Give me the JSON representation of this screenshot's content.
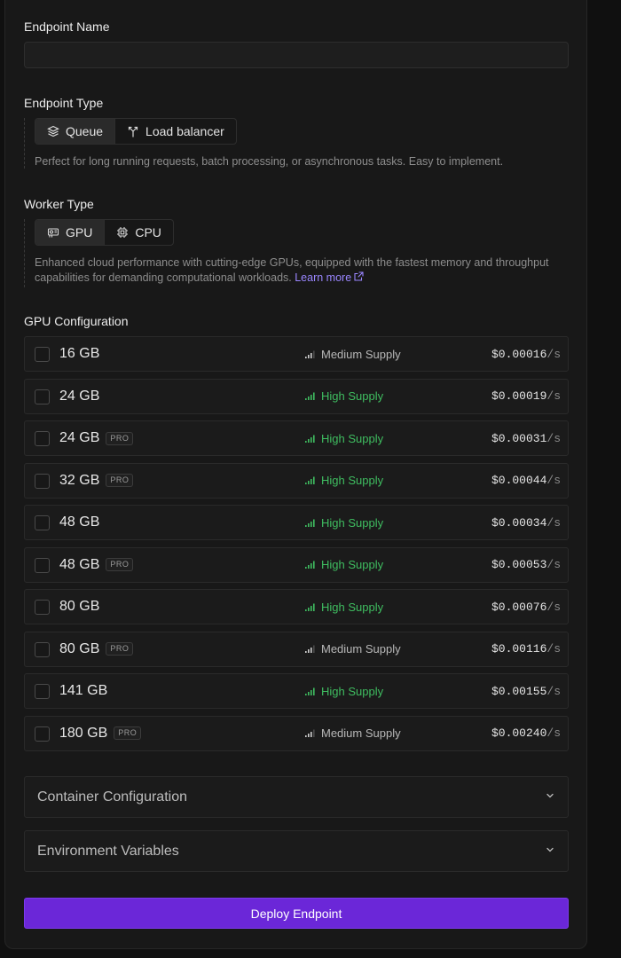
{
  "endpoint_name": {
    "label": "Endpoint Name",
    "value": "",
    "placeholder": ""
  },
  "endpoint_type": {
    "label": "Endpoint Type",
    "options": [
      {
        "label": "Queue",
        "icon": "layers-icon",
        "selected": true
      },
      {
        "label": "Load balancer",
        "icon": "split-arrow-icon",
        "selected": false
      }
    ],
    "description": "Perfect for long running requests, batch processing, or asynchronous tasks. Easy to implement."
  },
  "worker_type": {
    "label": "Worker Type",
    "options": [
      {
        "label": "GPU",
        "icon": "gpu-icon",
        "selected": true
      },
      {
        "label": "CPU",
        "icon": "cpu-icon",
        "selected": false
      }
    ],
    "description": "Enhanced cloud performance with cutting-edge GPUs, equipped with the fastest memory and throughput capabilities for demanding computational workloads.",
    "learn_more": "Learn more"
  },
  "gpu_configuration": {
    "label": "GPU Configuration",
    "unit_suffix": "/s",
    "rows": [
      {
        "size": "16 GB",
        "pro": false,
        "supply": "Medium Supply",
        "level": "medium",
        "price": "$0.00016"
      },
      {
        "size": "24 GB",
        "pro": false,
        "supply": "High Supply",
        "level": "high",
        "price": "$0.00019"
      },
      {
        "size": "24 GB",
        "pro": true,
        "supply": "High Supply",
        "level": "high",
        "price": "$0.00031"
      },
      {
        "size": "32 GB",
        "pro": true,
        "supply": "High Supply",
        "level": "high",
        "price": "$0.00044"
      },
      {
        "size": "48 GB",
        "pro": false,
        "supply": "High Supply",
        "level": "high",
        "price": "$0.00034"
      },
      {
        "size": "48 GB",
        "pro": true,
        "supply": "High Supply",
        "level": "high",
        "price": "$0.00053"
      },
      {
        "size": "80 GB",
        "pro": false,
        "supply": "High Supply",
        "level": "high",
        "price": "$0.00076"
      },
      {
        "size": "80 GB",
        "pro": true,
        "supply": "Medium Supply",
        "level": "medium",
        "price": "$0.00116"
      },
      {
        "size": "141 GB",
        "pro": false,
        "supply": "High Supply",
        "level": "high",
        "price": "$0.00155"
      },
      {
        "size": "180 GB",
        "pro": true,
        "supply": "Medium Supply",
        "level": "medium",
        "price": "$0.00240"
      }
    ],
    "pro_badge": "PRO"
  },
  "accordions": [
    {
      "label": "Container Configuration",
      "icon": "chevron-down-icon"
    },
    {
      "label": "Environment Variables",
      "icon": "chevron-down-icon"
    }
  ],
  "deploy_button": "Deploy Endpoint",
  "colors": {
    "accent": "#6b27d8",
    "high_supply": "#3fbd60",
    "medium_supply": "#b8b8b8",
    "link": "#9a86ff"
  }
}
